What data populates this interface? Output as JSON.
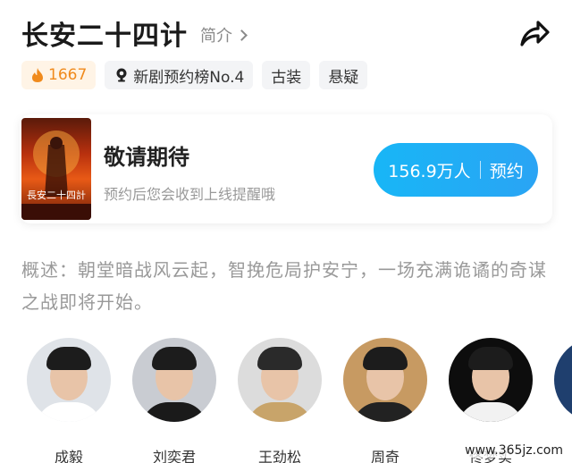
{
  "header": {
    "title": "长安二十四计",
    "intro_label": "简介"
  },
  "tags": [
    {
      "label": "1667",
      "icon": "flame-icon",
      "color": "#f08a1c"
    },
    {
      "label": "新剧预约榜No.4",
      "icon": "trophy-icon"
    },
    {
      "label": "古装"
    },
    {
      "label": "悬疑"
    }
  ],
  "card": {
    "poster_text": "長安二十四計",
    "title": "敬请期待",
    "subtitle": "预约后您会收到上线提醒哦",
    "count": "156.9万人",
    "action": "预约",
    "accent": "#18b6f6"
  },
  "summary": "概述：朝堂暗战风云起，智挽危局护安宁，一场充满诡谲的奇谋之战即将开始。",
  "cast": [
    {
      "name": "成毅"
    },
    {
      "name": "刘奕君"
    },
    {
      "name": "王劲松"
    },
    {
      "name": "周奇"
    },
    {
      "name": "佟梦实"
    }
  ],
  "watermark": "www.365jz.com"
}
